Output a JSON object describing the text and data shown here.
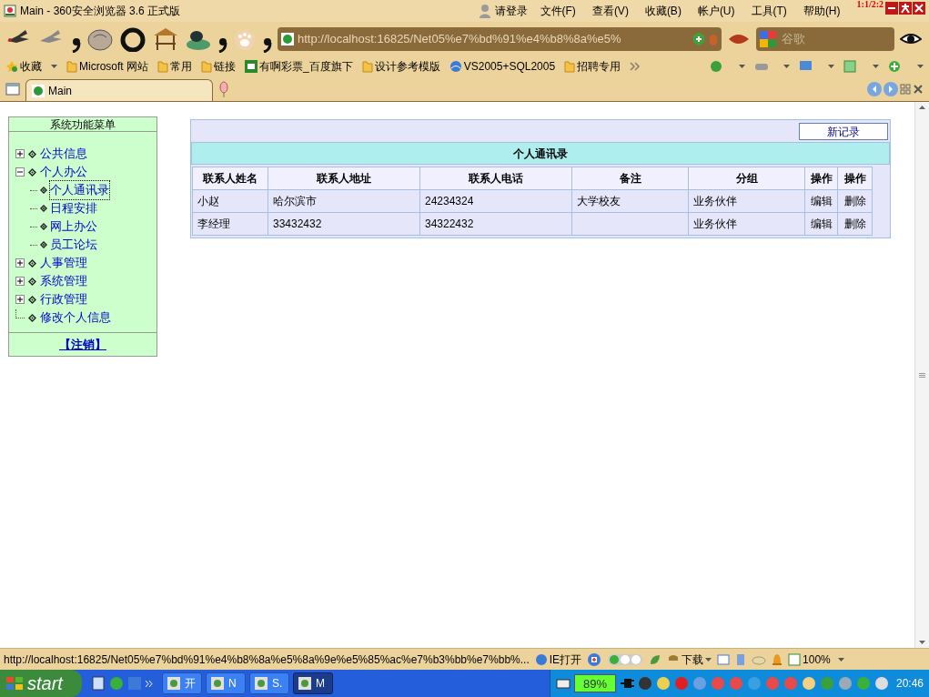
{
  "window": {
    "title": "Main - 360安全浏览器 3.6 正式版",
    "menu": [
      "请登录",
      "文件(F)",
      "查看(V)",
      "收藏(B)",
      "帐户(U)",
      "工具(T)",
      "帮助(H)"
    ],
    "overlay_text": "1:1/2:2"
  },
  "address_bar": {
    "value": "http://localhost:16825/Net05%e7%bd%91%e4%b8%8a%e5%"
  },
  "search": {
    "placeholder": "谷歌"
  },
  "favorites": [
    {
      "label": "收藏",
      "kind": "menu"
    },
    {
      "label": "Microsoft 网站",
      "kind": "folder"
    },
    {
      "label": "常用",
      "kind": "folder"
    },
    {
      "label": "链接",
      "kind": "folder"
    },
    {
      "label": "有啊彩票_百度旗下",
      "kind": "site"
    },
    {
      "label": "设计参考模版",
      "kind": "folder"
    },
    {
      "label": "VS2005+SQL2005",
      "kind": "link"
    },
    {
      "label": "招聘专用",
      "kind": "folder"
    }
  ],
  "tabs": [
    {
      "label": "Main",
      "selected": true
    }
  ],
  "sidebar": {
    "title": "系统功能菜单",
    "items": [
      {
        "label": "公共信息",
        "kind": "group",
        "expanded": false,
        "selected": false
      },
      {
        "label": "个人办公",
        "kind": "group",
        "expanded": true,
        "selected": false,
        "children": [
          {
            "label": "个人通讯录",
            "selected": true
          },
          {
            "label": "日程安排",
            "selected": false
          },
          {
            "label": "网上办公",
            "selected": false
          },
          {
            "label": "员工论坛",
            "selected": false
          }
        ]
      },
      {
        "label": "人事管理",
        "kind": "group",
        "expanded": false,
        "selected": false
      },
      {
        "label": "系统管理",
        "kind": "group",
        "expanded": false,
        "selected": false
      },
      {
        "label": "行政管理",
        "kind": "group",
        "expanded": false,
        "selected": false
      },
      {
        "label": "修改个人信息",
        "kind": "leaf",
        "selected": false
      }
    ],
    "logout": "【注销】"
  },
  "content": {
    "new_button": "新记录",
    "table": {
      "title": "个人通讯录",
      "columns": [
        "联系人姓名",
        "联系人地址",
        "联系人电话",
        "备注",
        "分组",
        "操作",
        "操作"
      ],
      "rows": [
        {
          "name": "小赵",
          "address": "哈尔滨市",
          "phone": "24234324",
          "note": "大学校友",
          "group": "业务伙伴",
          "edit": "编辑",
          "delete": "删除"
        },
        {
          "name": "李经理",
          "address": "33432432",
          "phone": "34322432",
          "group": "业务伙伴",
          "edit": "编辑",
          "delete": "删除"
        }
      ]
    }
  },
  "status_bar": {
    "url": "http://localhost:16825/Net05%e7%bd%91%e4%b8%8a%e5%8a%9e%e5%85%ac%e7%b3%bb%e7%bb%...",
    "ie_open": "IE打开",
    "download": "下载",
    "zoom": "100%"
  },
  "taskbar": {
    "start": "start",
    "tasks": [
      {
        "label": "开",
        "selected": false
      },
      {
        "label": "N",
        "selected": false
      },
      {
        "label": "S.",
        "selected": false
      },
      {
        "label": "M",
        "selected": true
      }
    ],
    "battery": "89%",
    "clock": "20:46"
  }
}
